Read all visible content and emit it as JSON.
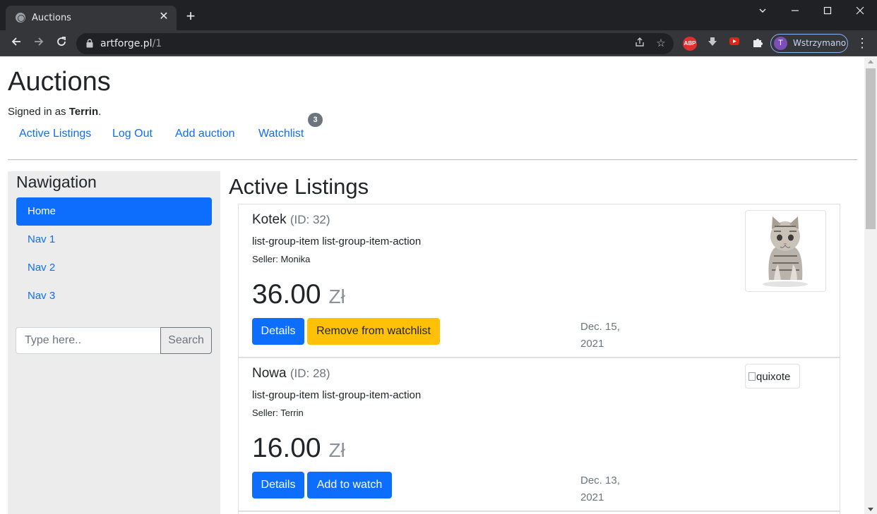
{
  "browser": {
    "tab_title": "Auctions",
    "url_host": "artforge.pl",
    "url_path": "/1",
    "profile_initial": "T",
    "profile_label": "Wstrzymano",
    "adblock_label": "ABP"
  },
  "site": {
    "title": "Auctions",
    "signed_in_prefix": "Signed in as ",
    "username": "Terrin",
    "signed_in_suffix": ".",
    "nav": {
      "active_listings": "Active Listings",
      "log_out": "Log Out",
      "add_auction": "Add auction",
      "watchlist": "Watchlist",
      "watchlist_count": "3"
    }
  },
  "sidebar": {
    "title": "Nawigation",
    "items": [
      {
        "label": "Home",
        "active": true
      },
      {
        "label": "Nav 1",
        "active": false
      },
      {
        "label": "Nav 2",
        "active": false
      },
      {
        "label": "Nav 3",
        "active": false
      }
    ],
    "search_placeholder": "Type here..",
    "search_button": "Search"
  },
  "main": {
    "title": "Active Listings",
    "listings": [
      {
        "name": "Kotek",
        "id_label": "(ID: 32)",
        "description": "list-group-item list-group-item-action",
        "seller": "Seller: Monika",
        "price": "36.00",
        "currency": "Zł",
        "details_label": "Details",
        "watch_label": "Remove from watchlist",
        "date_line1": "Dec. 15,",
        "date_line2": "2021",
        "image": "kitten-photo"
      },
      {
        "name": "Nowa",
        "id_label": "(ID: 28)",
        "description": "list-group-item list-group-item-action",
        "seller": "Seller: Terrin",
        "price": "16.00",
        "currency": "Zł",
        "details_label": "Details",
        "watch_label": "Add to watch",
        "date_line1": "Dec. 13,",
        "date_line2": "2021",
        "image_alt": "quixote"
      }
    ]
  },
  "colors": {
    "primary": "#0d6efd",
    "warning": "#ffc107",
    "secondary": "#6c757d"
  }
}
